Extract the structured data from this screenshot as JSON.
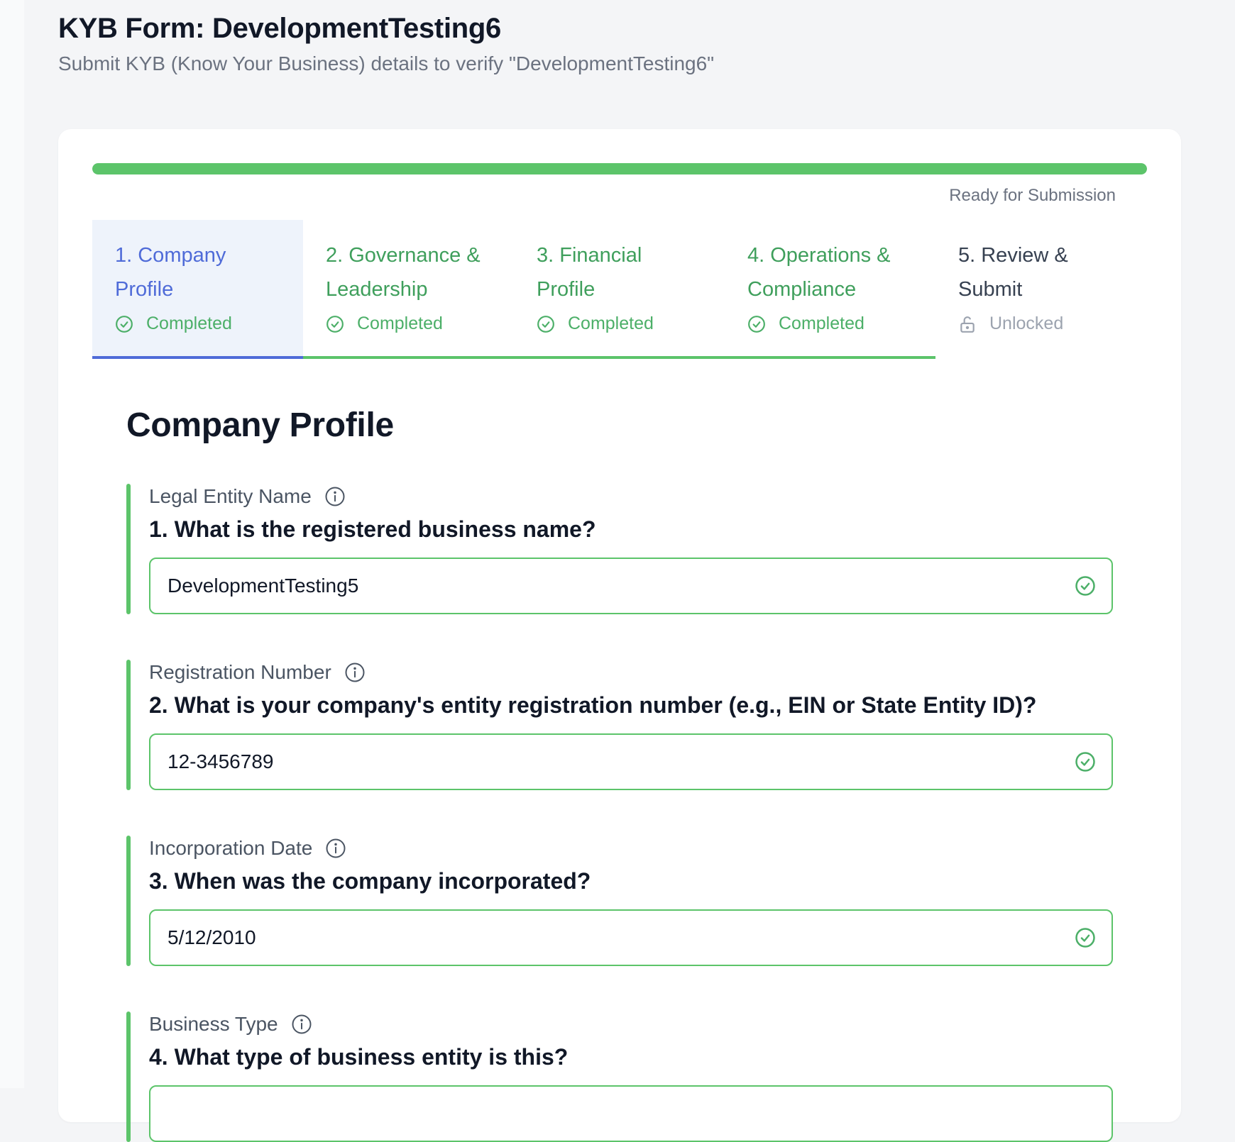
{
  "header": {
    "title": "KYB Form: DevelopmentTesting6",
    "subtitle": "Submit KYB (Know Your Business) details to verify \"DevelopmentTesting6\""
  },
  "progress": {
    "percent": 100,
    "status_text": "Ready for Submission"
  },
  "colors": {
    "success": "#5cc46a",
    "active": "#4f6bd8",
    "muted": "#9ca3af"
  },
  "tabs": [
    {
      "line1": "1. Company",
      "line2": "Profile",
      "status": "Completed",
      "state": "active",
      "icon": "check-circle-icon"
    },
    {
      "line1": "2. Governance &",
      "line2": "Leadership",
      "status": "Completed",
      "state": "completed",
      "icon": "check-circle-icon"
    },
    {
      "line1": "3. Financial",
      "line2": "Profile",
      "status": "Completed",
      "state": "completed",
      "icon": "check-circle-icon"
    },
    {
      "line1": "4. Operations &",
      "line2": "Compliance",
      "status": "Completed",
      "state": "completed",
      "icon": "check-circle-icon"
    },
    {
      "line1": "5. Review &",
      "line2": "Submit",
      "status": "Unlocked",
      "state": "locked",
      "icon": "unlock-icon"
    }
  ],
  "section": {
    "title": "Company Profile"
  },
  "questions": [
    {
      "label": "Legal Entity Name",
      "question": "1. What is the registered business name?",
      "value": "DevelopmentTesting5"
    },
    {
      "label": "Registration Number",
      "question": "2. What is your company's entity registration number (e.g., EIN or State Entity ID)?",
      "value": "12-3456789"
    },
    {
      "label": "Incorporation Date",
      "question": "3. When was the company incorporated?",
      "value": "5/12/2010"
    },
    {
      "label": "Business Type",
      "question": "4. What type of business entity is this?",
      "value": ""
    }
  ]
}
